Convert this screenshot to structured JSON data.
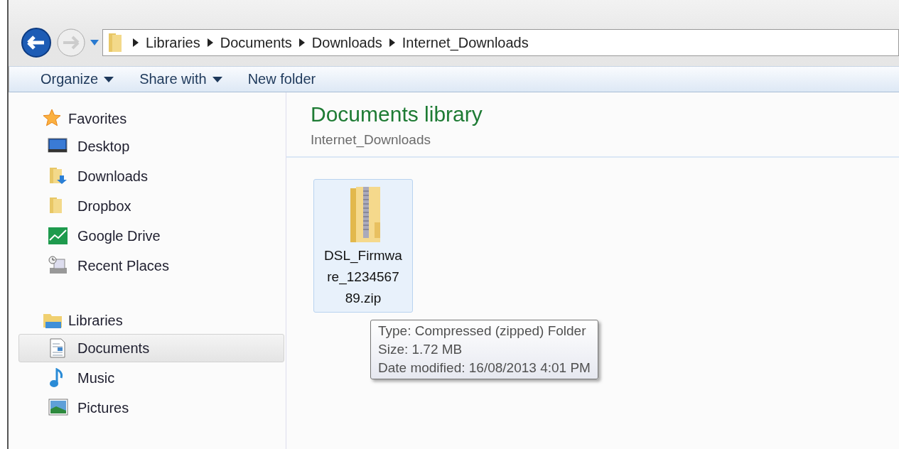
{
  "address_bar": {
    "back_disabled": false,
    "forward_disabled": true,
    "path": [
      "Libraries",
      "Documents",
      "Downloads",
      "Internet_Downloads"
    ]
  },
  "toolbar": {
    "buttons": [
      {
        "label": "Organize",
        "dropdown": true
      },
      {
        "label": "Share with",
        "dropdown": true
      },
      {
        "label": "New folder",
        "dropdown": false
      }
    ]
  },
  "navigation_pane": {
    "groups": [
      {
        "label": "Favorites",
        "kind": "star",
        "items": [
          {
            "label": "Desktop",
            "kind": "desktop",
            "selected": false
          },
          {
            "label": "Downloads",
            "kind": "downloads",
            "selected": false
          },
          {
            "label": "Dropbox",
            "kind": "folder",
            "selected": false
          },
          {
            "label": "Google Drive",
            "kind": "drive",
            "selected": false
          },
          {
            "label": "Recent Places",
            "kind": "recent",
            "selected": false
          }
        ]
      },
      {
        "label": "Libraries",
        "kind": "library",
        "items": [
          {
            "label": "Documents",
            "kind": "document",
            "selected": true
          },
          {
            "label": "Music",
            "kind": "music",
            "selected": false
          },
          {
            "label": "Pictures",
            "kind": "pictures",
            "selected": false
          }
        ]
      }
    ]
  },
  "content": {
    "title": "Documents library",
    "subtitle": "Internet_Downloads",
    "files": [
      {
        "name": "DSL_Firmware_123456789.zip",
        "selected": true
      }
    ],
    "tooltip": {
      "lines": [
        "Type: Compressed (zipped) Folder",
        "Size: 1.72 MB",
        "Date modified: 16/08/2013 4:01 PM"
      ]
    }
  }
}
